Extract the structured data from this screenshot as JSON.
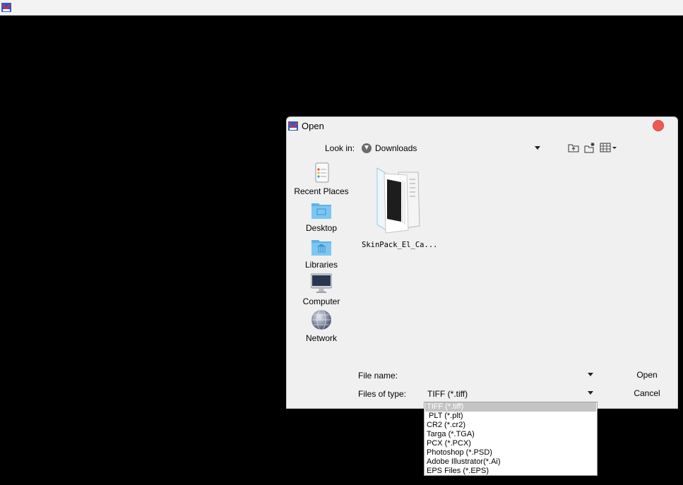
{
  "dialog": {
    "title": "Open",
    "look_in_label": "Look in:",
    "look_in_value": "Downloads"
  },
  "places": [
    {
      "label": "Recent Places",
      "icon": "recent-places-icon"
    },
    {
      "label": "Desktop",
      "icon": "desktop-folder-icon"
    },
    {
      "label": "Libraries",
      "icon": "libraries-folder-icon"
    },
    {
      "label": "Computer",
      "icon": "computer-icon"
    },
    {
      "label": "Network",
      "icon": "network-globe-icon"
    }
  ],
  "files": [
    {
      "name": "SkinPack_El_Ca..."
    }
  ],
  "file_name": {
    "label": "File name:",
    "value": ""
  },
  "files_of_type": {
    "label": "Files of type:",
    "value": "TIFF (*.tiff)",
    "options": [
      "TIFF (*.tiff)",
      " PLT (*.plt)",
      "CR2 (*.cr2)",
      "Targa (*.TGA)",
      "PCX (*.PCX)",
      "Photoshop (*.PSD)",
      "Adobe Illustrator(*.Ai)",
      "EPS Files (*.EPS)"
    ],
    "selected_index": 0
  },
  "buttons": {
    "open": "Open",
    "cancel": "Cancel"
  },
  "colors": {
    "close": "#ee5a53",
    "folder": "#5fb3e8",
    "selected_option": "#c4c4c4"
  }
}
